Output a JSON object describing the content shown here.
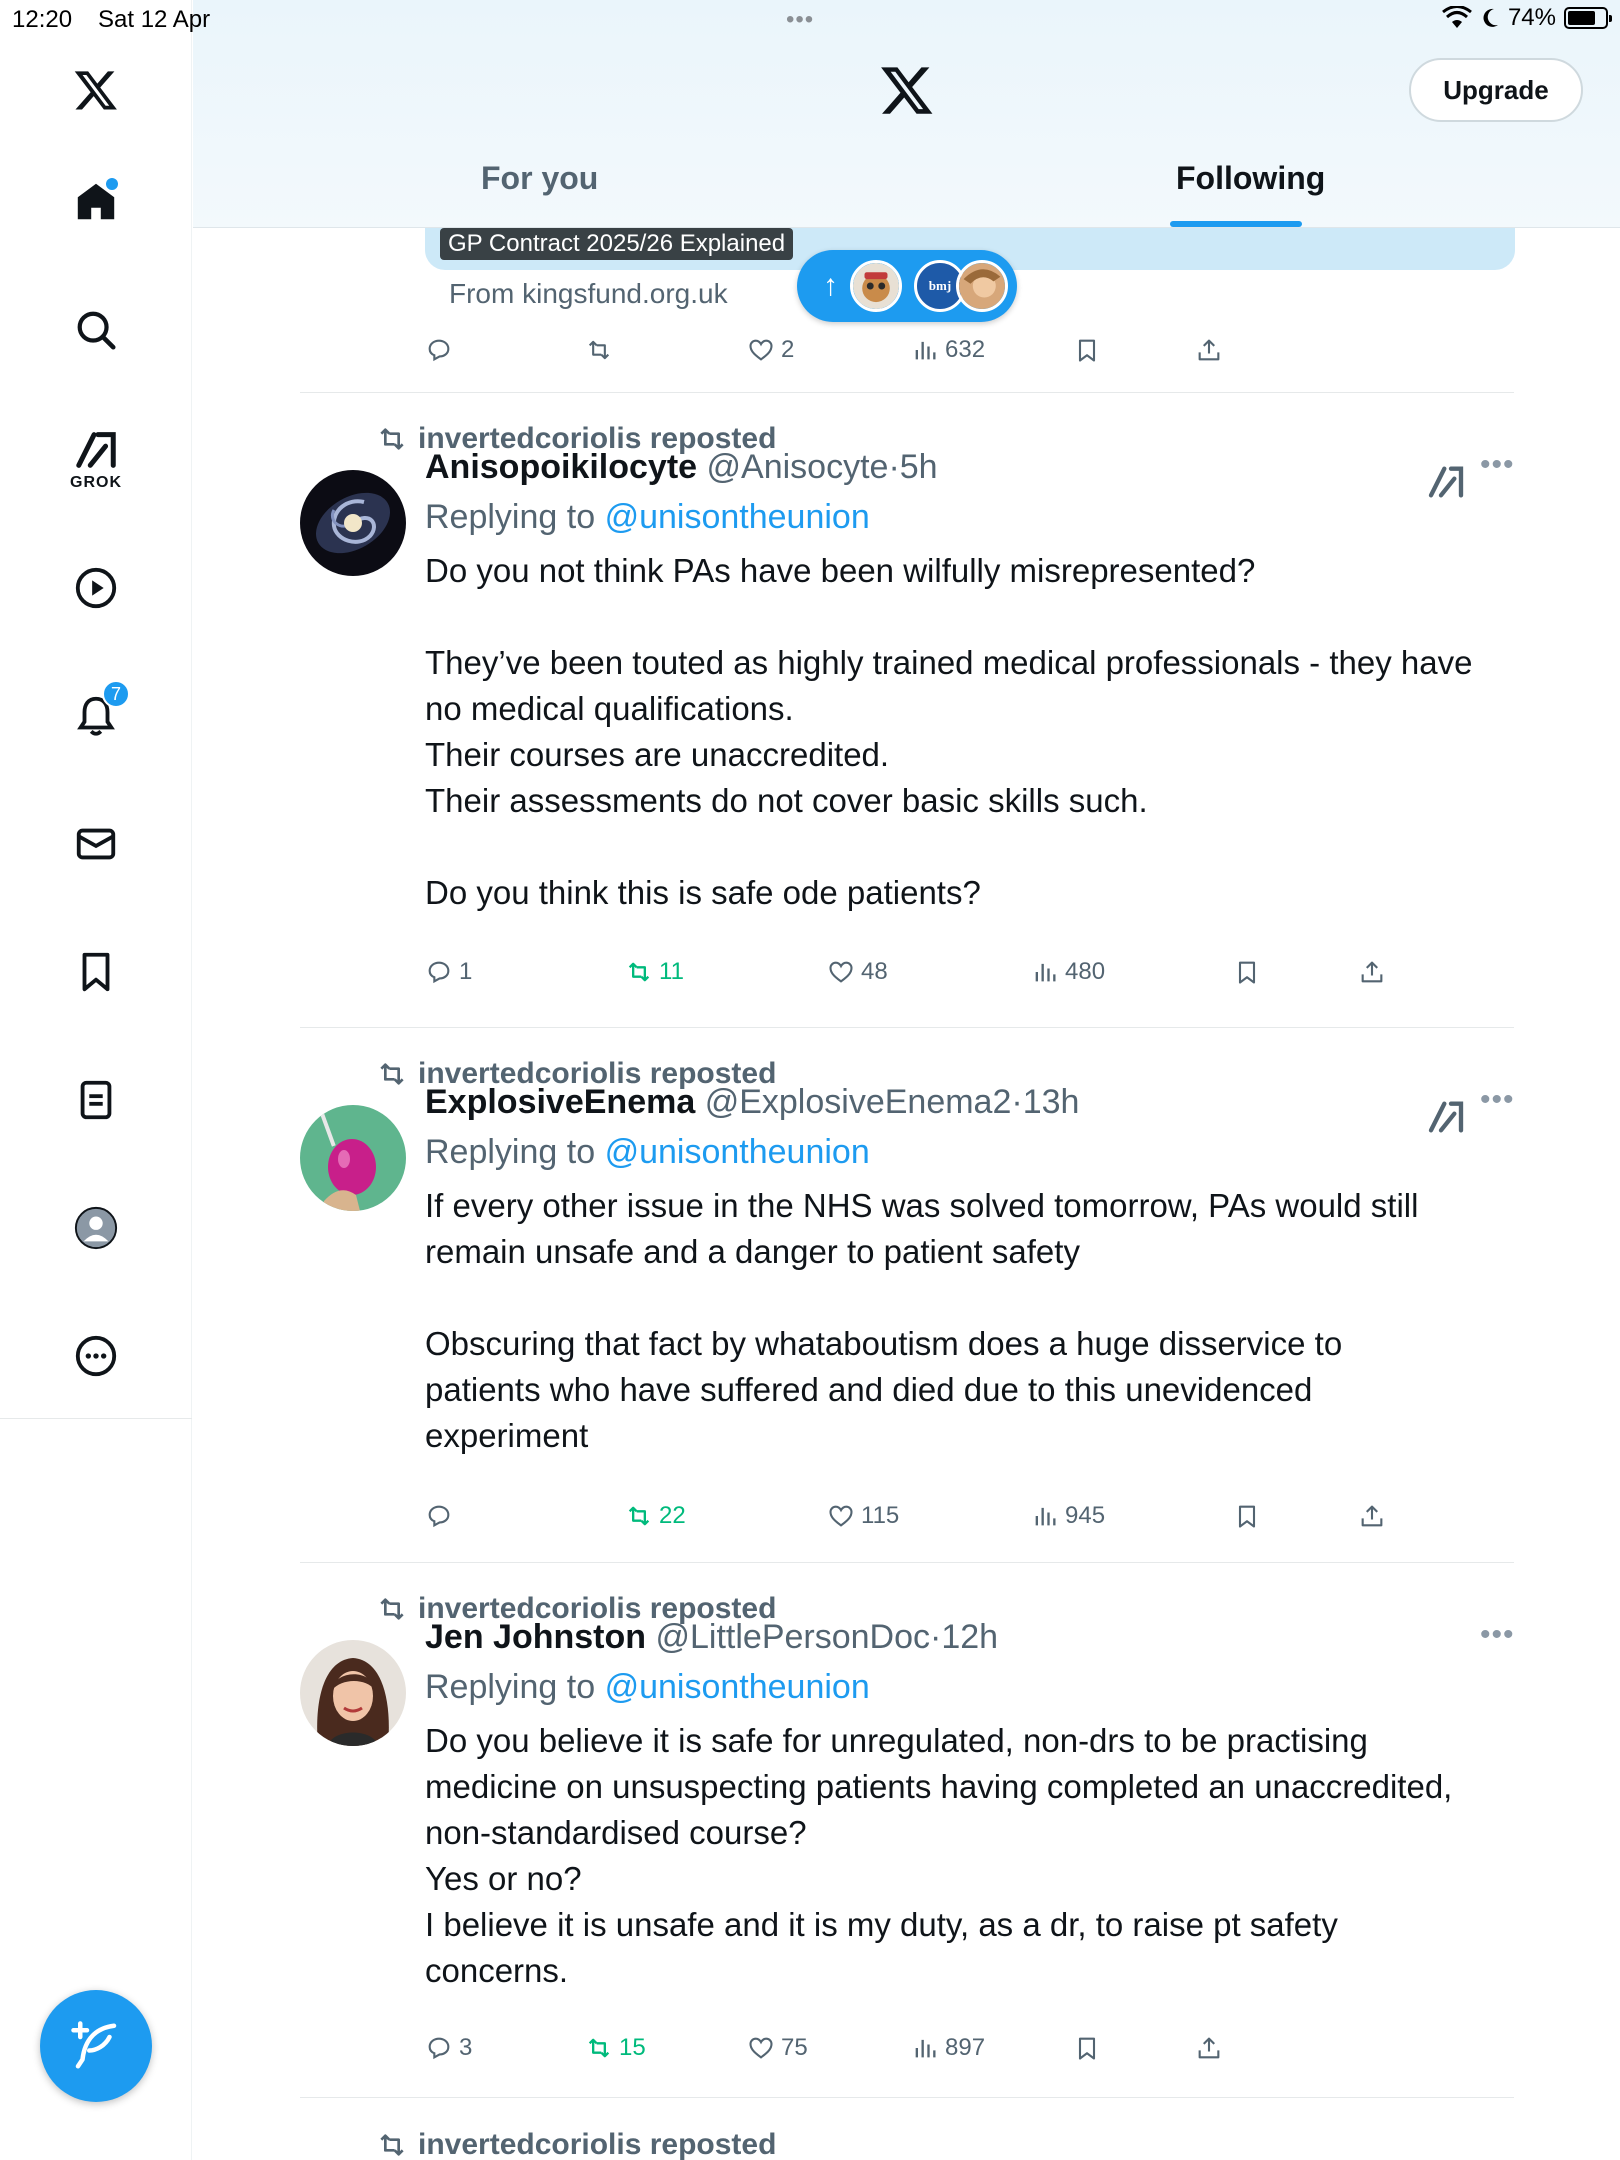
{
  "status_bar": {
    "time": "12:20",
    "date": "Sat 12 Apr",
    "dots": "•••",
    "battery": "74%",
    "battery_level": 0.74
  },
  "sidebar": {
    "grok_label": "GROK",
    "notifications_badge": "7"
  },
  "header": {
    "upgrade_label": "Upgrade",
    "tabs": [
      {
        "label": "For you"
      },
      {
        "label": "Following"
      }
    ]
  },
  "partial_post": {
    "card_title": "GP Contract 2025/26 Explained",
    "from": "From kingsfund.org.uk",
    "likes": "2",
    "views": "632"
  },
  "new_posts_pill": {
    "avatars": [
      "sloth-avatar",
      "bmj-avatar",
      "face-avatar"
    ],
    "bmj_text": "bmj"
  },
  "tweets": [
    {
      "reposted_by": "invertedcoriolis reposted",
      "name": "Anisopoikilocyte",
      "handle": "@Anisocyte",
      "time": "5h",
      "replying_prefix": "Replying to",
      "replying_to": "@unisontheunion",
      "lines": [
        "Do you not think PAs have been wilfully misrepresented?",
        "",
        "They’ve been touted as highly trained medical professionals - they have",
        "no medical qualifications.",
        "Their courses are unaccredited.",
        "Their assessments do not cover basic skills such.",
        "",
        "Do you think this is safe ode patients?"
      ],
      "replies": "1",
      "reposts": "11",
      "likes": "48",
      "views": "480"
    },
    {
      "reposted_by": "invertedcoriolis reposted",
      "name": "ExplosiveEnema",
      "handle": "@ExplosiveEnema2",
      "time": "13h",
      "replying_prefix": "Replying to",
      "replying_to": "@unisontheunion",
      "lines": [
        "If every other issue in the NHS was solved tomorrow, PAs would still",
        "remain unsafe and a danger to patient safety",
        "",
        "Obscuring that fact by whataboutism does a huge disservice to",
        "patients who have suffered and died due to this unevidenced",
        "experiment"
      ],
      "replies": "",
      "reposts": "22",
      "likes": "115",
      "views": "945"
    },
    {
      "reposted_by": "invertedcoriolis reposted",
      "name": "Jen Johnston",
      "handle": "@LittlePersonDoc",
      "time": "12h",
      "replying_prefix": "Replying to",
      "replying_to": "@unisontheunion",
      "lines": [
        "Do you believe it is safe for unregulated, non-drs to be practising",
        "medicine on unsuspecting patients having completed an unaccredited,",
        "non-standardised course?",
        "Yes or no?",
        "I believe it is unsafe and it is my duty, as a dr, to raise pt safety",
        "concerns."
      ],
      "replies": "3",
      "reposts": "15",
      "likes": "75",
      "views": "897"
    }
  ],
  "next_tweet": {
    "reposted_by": "invertedcoriolis reposted"
  },
  "colors": {
    "accent": "#1d9bf0",
    "repost_green": "#00ba7c",
    "secondary_text": "#536471"
  }
}
